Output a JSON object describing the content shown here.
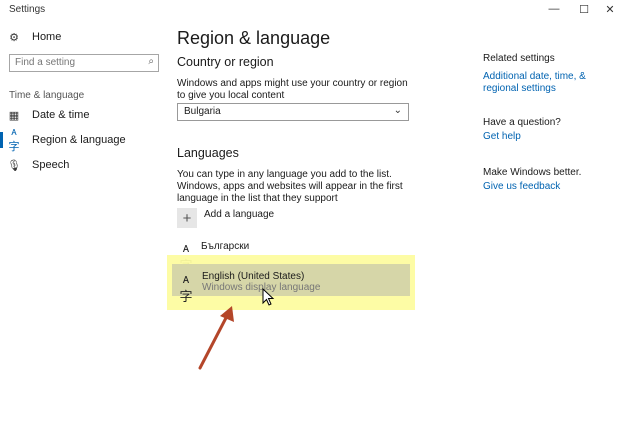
{
  "window": {
    "title": "Settings",
    "minimize": "—",
    "maximize": "☐",
    "close": "✕"
  },
  "sidebar": {
    "home": "Home",
    "search_placeholder": "Find a setting",
    "section": "Time & language",
    "items": [
      {
        "label": "Date & time",
        "icon": "calendar-clock-icon"
      },
      {
        "label": "Region & language",
        "icon": "region-language-icon",
        "active": true
      },
      {
        "label": "Speech",
        "icon": "microphone-icon"
      }
    ]
  },
  "main": {
    "title": "Region & language",
    "country": {
      "header": "Country or region",
      "description": "Windows and apps might use your country or region to give you local content",
      "value": "Bulgaria"
    },
    "languages": {
      "header": "Languages",
      "description": "You can type in any language you add to the list. Windows, apps and websites will appear in the first language in the list that they support",
      "add_label": "Add a language",
      "list": [
        {
          "name": "Български",
          "sub": ""
        },
        {
          "name": "English (United States)",
          "sub": "Windows display language"
        }
      ]
    }
  },
  "right": {
    "related_header": "Related settings",
    "related_link": "Additional date, time, & regional settings",
    "question_header": "Have a question?",
    "question_link": "Get help",
    "better_header": "Make Windows better.",
    "better_link": "Give us feedback"
  },
  "colors": {
    "accent": "#0063b1",
    "highlight": "#fdfca0",
    "arrow": "#b4462a"
  }
}
